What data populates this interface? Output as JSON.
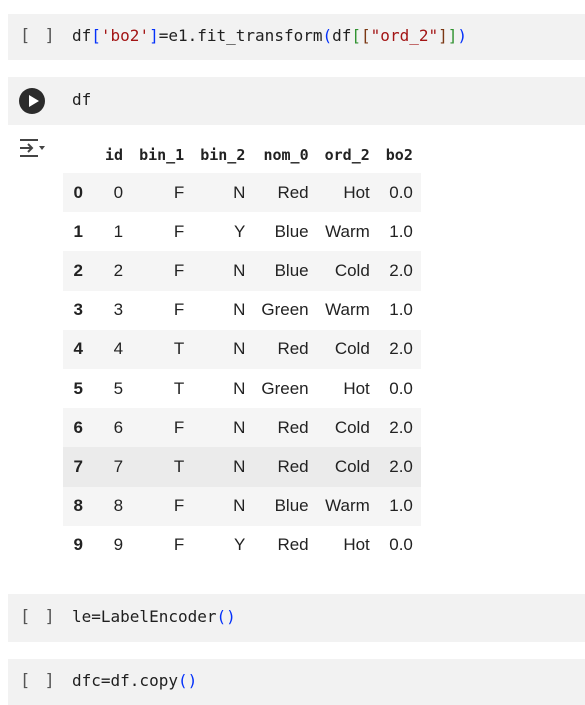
{
  "cells": {
    "bracket": "[ ]",
    "cell1_tokens": [
      {
        "t": "df",
        "c": ""
      },
      {
        "t": "[",
        "c": "tok-bracket1"
      },
      {
        "t": "'bo2'",
        "c": "tok-str"
      },
      {
        "t": "]",
        "c": "tok-bracket1"
      },
      {
        "t": "=e1.fit_transform",
        "c": ""
      },
      {
        "t": "(",
        "c": "tok-bracket1"
      },
      {
        "t": "df",
        "c": ""
      },
      {
        "t": "[",
        "c": "tok-bracket2"
      },
      {
        "t": "[",
        "c": "tok-bracket3"
      },
      {
        "t": "\"ord_2\"",
        "c": "tok-str"
      },
      {
        "t": "]",
        "c": "tok-bracket3"
      },
      {
        "t": "]",
        "c": "tok-bracket2"
      },
      {
        "t": ")",
        "c": "tok-bracket1"
      }
    ],
    "cell2_code": "df",
    "cell3_tokens": [
      {
        "t": "le=LabelEncoder",
        "c": ""
      },
      {
        "t": "()",
        "c": "tok-paren"
      }
    ],
    "cell4_tokens": [
      {
        "t": "dfc=df.copy",
        "c": ""
      },
      {
        "t": "()",
        "c": "tok-paren"
      }
    ]
  },
  "dataframe": {
    "columns": [
      "id",
      "bin_1",
      "bin_2",
      "nom_0",
      "ord_2",
      "bo2"
    ],
    "rows": [
      {
        "index": "0",
        "cells": [
          "0",
          "F",
          "N",
          "Red",
          "Hot",
          "0.0"
        ]
      },
      {
        "index": "1",
        "cells": [
          "1",
          "F",
          "Y",
          "Blue",
          "Warm",
          "1.0"
        ]
      },
      {
        "index": "2",
        "cells": [
          "2",
          "F",
          "N",
          "Blue",
          "Cold",
          "2.0"
        ]
      },
      {
        "index": "3",
        "cells": [
          "3",
          "F",
          "N",
          "Green",
          "Warm",
          "1.0"
        ]
      },
      {
        "index": "4",
        "cells": [
          "4",
          "T",
          "N",
          "Red",
          "Cold",
          "2.0"
        ]
      },
      {
        "index": "5",
        "cells": [
          "5",
          "T",
          "N",
          "Green",
          "Hot",
          "0.0"
        ]
      },
      {
        "index": "6",
        "cells": [
          "6",
          "F",
          "N",
          "Red",
          "Cold",
          "2.0"
        ]
      },
      {
        "index": "7",
        "cells": [
          "7",
          "T",
          "N",
          "Red",
          "Cold",
          "2.0"
        ]
      },
      {
        "index": "8",
        "cells": [
          "8",
          "F",
          "N",
          "Blue",
          "Warm",
          "1.0"
        ]
      },
      {
        "index": "9",
        "cells": [
          "9",
          "F",
          "Y",
          "Red",
          "Hot",
          "0.0"
        ]
      }
    ],
    "hovered_row": "7"
  },
  "icons": {
    "run": "play-circle-icon",
    "output": "output-options-icon"
  }
}
